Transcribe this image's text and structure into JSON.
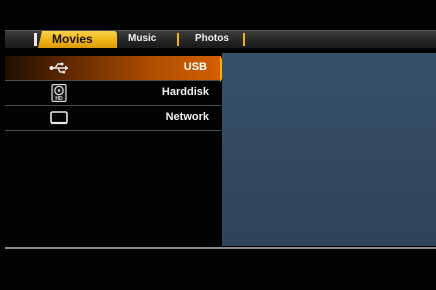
{
  "tabs": {
    "active": "Movies",
    "music": "Music",
    "photos": "Photos"
  },
  "sources": [
    {
      "label": "USB",
      "icon": "usb-icon",
      "selected": true
    },
    {
      "label": "Harddisk",
      "icon": "harddisk-icon",
      "selected": false
    },
    {
      "label": "Network",
      "icon": "network-icon",
      "selected": false
    }
  ],
  "colors": {
    "accent": "#f0b316",
    "selection": "#d46000",
    "preview": "#34495e"
  }
}
